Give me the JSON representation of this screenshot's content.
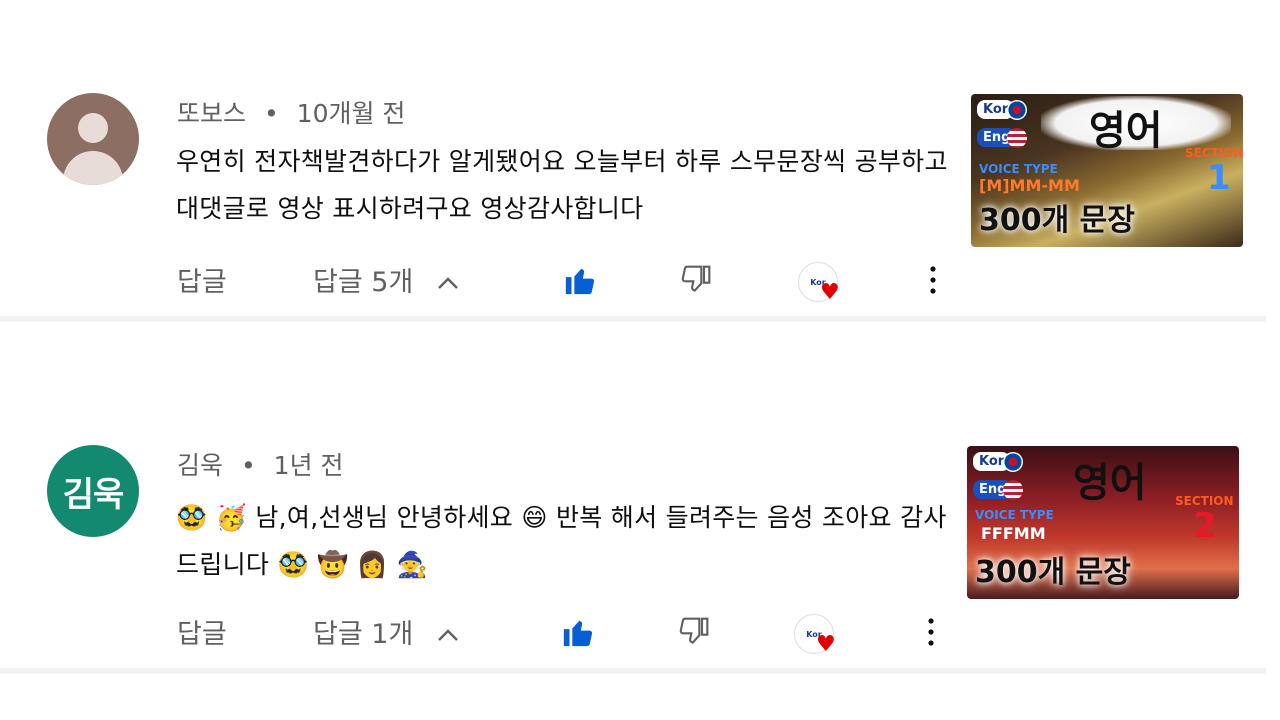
{
  "comments": [
    {
      "author": "또보스",
      "time": "10개월 전",
      "text": "우연히 전자책발견하다가  알게됐어요 오늘부터 하루 스무문장씩 공부하고 대댓글로 영상 표시하려구요 영상감사합니다",
      "reply_label": "답글",
      "replies_label": "답글 5개",
      "thumbnail": {
        "tag_kor": "Kor",
        "tag_eng": "Eng",
        "title": "영어",
        "voice": "VOICE TYPE",
        "type": "[M]MM-MM",
        "section": "SECTION",
        "number": "1",
        "count": "300개 문장"
      }
    },
    {
      "author": "김욱",
      "avatar_initials": "김욱",
      "time": "1년 전",
      "text": "🥸 🥳 남,여,선생님 안녕하세요 😄 반복 해서 들려주는 음성 조아요 감사드립니다 🥸 🤠 👩 🧙",
      "reply_label": "답글",
      "replies_label": "답글 1개",
      "thumbnail": {
        "tag_kor": "Kor",
        "tag_eng": "Eng",
        "title": "영어",
        "voice": "VOICE TYPE",
        "type": "FFFMM",
        "section": "SECTION",
        "number": "2",
        "count": "300개 문장"
      }
    }
  ],
  "separator": "•",
  "heart_avatar_label": "Kor",
  "colors": {
    "like_blue": "#065fd4",
    "heart_red": "#e00000",
    "avatar_teal": "#138a70",
    "avatar_brown": "#8d6e63"
  }
}
